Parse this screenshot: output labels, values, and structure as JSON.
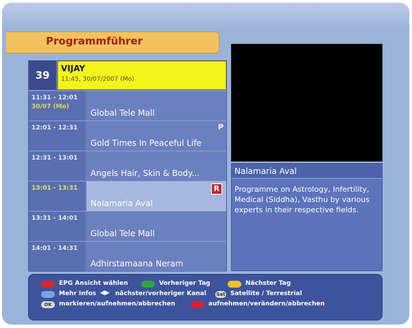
{
  "header": {
    "title": "Programmführer"
  },
  "channel": {
    "number": "39",
    "name": "VIJAY",
    "datetime": "11:45, 30/07/2007 (Mo)"
  },
  "programs": [
    {
      "time": "11:31 - 12:01",
      "sub": "30/07 (Mo)",
      "title": "Global Tele Mall",
      "tag": ""
    },
    {
      "time": "12:01 - 12:31",
      "sub": "",
      "title": "Gold Times In Peaceful Life",
      "tag": "P"
    },
    {
      "time": "12:31 - 13:01",
      "sub": "",
      "title": "Angels Hair, Skin & Body...",
      "tag": ""
    },
    {
      "time": "13:01 - 13:31",
      "sub": "",
      "title": "Nalamaria Aval",
      "tag": "R"
    },
    {
      "time": "13:31 - 14:01",
      "sub": "",
      "title": "Global Tele Mall",
      "tag": ""
    },
    {
      "time": "14:01 - 14:31",
      "sub": "",
      "title": "Adhirstamaana Neram",
      "tag": ""
    }
  ],
  "selected_index": 3,
  "info": {
    "title": "Nalamaria Aval",
    "description": "Programme on Astrology, Infertility, Medical (Siddha), Vasthu by various experts in their respective fields."
  },
  "footer": {
    "red_label": "EPG Ansicht wählen",
    "green_label": "Vorheriger Tag",
    "yellow_label": "Nächster Tag",
    "blue_label": "Mehr Infos",
    "arrows_label": "nächster/vorheriger Kanal",
    "sat_label": "Satellite / Terrestrial",
    "ok_label": "markieren/aufnehmen/abbrechen",
    "rec_label": "aufnehmen/verändern/abbrechen",
    "ok_key": "OK",
    "sat_key": "Sat"
  },
  "colors": {
    "red": "#d6242b",
    "green": "#2ea43a",
    "yellow": "#f0c22a",
    "blue": "#7ea1e6",
    "highlight": "#f1f51a",
    "header": "#f3c25e"
  }
}
